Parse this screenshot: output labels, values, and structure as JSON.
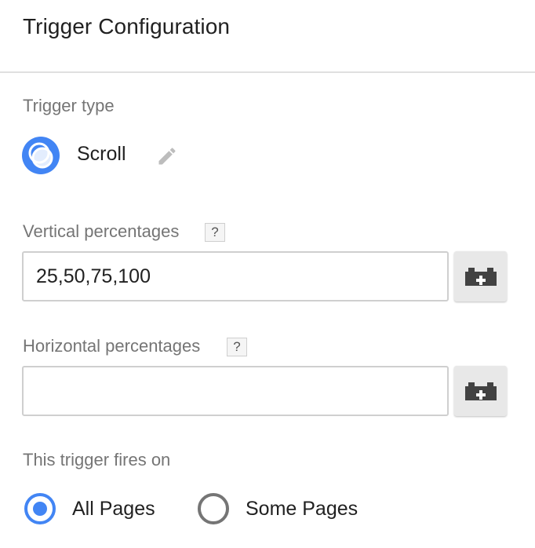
{
  "header": {
    "title": "Trigger Configuration"
  },
  "trigger_type": {
    "label": "Trigger type",
    "name": "Scroll",
    "icon": "scroll-trigger-icon",
    "icon_color": "#4285f4"
  },
  "vertical": {
    "label": "Vertical percentages",
    "help": "?",
    "value": "25,50,75,100",
    "placeholder": ""
  },
  "horizontal": {
    "label": "Horizontal percentages",
    "help": "?",
    "value": "",
    "placeholder": ""
  },
  "fires_on": {
    "label": "This trigger fires on",
    "options": [
      {
        "label": "All Pages",
        "selected": true
      },
      {
        "label": "Some Pages",
        "selected": false
      }
    ]
  },
  "colors": {
    "accent": "#4285f4",
    "text": "#212121",
    "muted": "#757575"
  }
}
